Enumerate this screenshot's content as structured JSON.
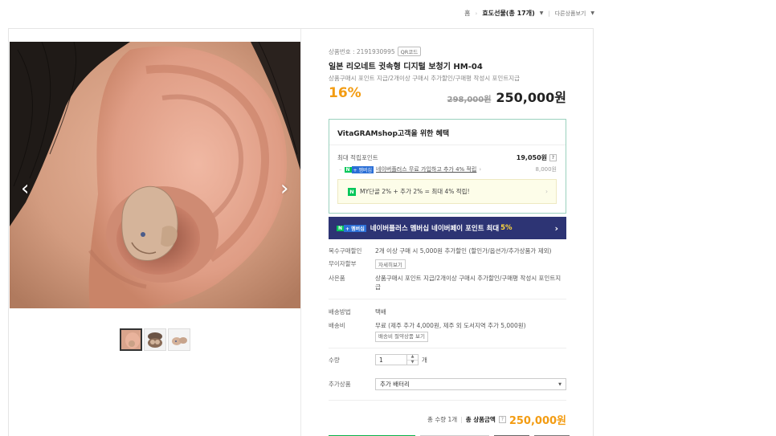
{
  "breadcrumb": {
    "home": "홈",
    "category": "효도선물(총 17개)",
    "other": "다른상품보기"
  },
  "product": {
    "number_label": "상품번호 : 2191930995",
    "qr_label": "QR코드",
    "title": "일본 리오네트 귓속형 디지털 보청기 HM-04",
    "description": "상품구매시 포인트 지급/2개이상 구매시 추가할인/구매평 작성시 포인트지급",
    "discount": "16%",
    "original_price": "298,000원",
    "sale_price": "250,000원"
  },
  "benefit": {
    "title": "VitaGRAMshop고객을 위한 혜택",
    "points_label": "최대 적립포인트",
    "points_value": "19,050원",
    "help": "?",
    "naver_badge_n": "N",
    "naver_badge_plus": "+ 멤버십",
    "naver_text": "네이버플러스 무료 가입하고 추가 4% 적립",
    "naver_amount": "8,000원",
    "my_text": "MY단골 2% + 추가 2% = 최대 4% 적립!",
    "my_badge": "N"
  },
  "banner": {
    "badge_n": "N",
    "badge_plus": "+ 멤버십",
    "text": "네이버플러스 멤버십 네이버페이 포인트 최대",
    "highlight": "5%"
  },
  "info_rows": {
    "multi_label": "복수구매할인",
    "multi_value": "2개 이상 구매 시 5,000원 추가할인 (할인가/옵션가/추가상품가 제외)",
    "interest_label": "무이자할부",
    "interest_btn": "자세히보기",
    "gift_label": "사은품",
    "gift_value": "상품구매시 포인트 지급/2개이상 구매시 추가할인/구매평 작성시 포인트지급",
    "ship_method_label": "배송방법",
    "ship_method_value": "택배",
    "ship_fee_label": "배송비",
    "ship_fee_value": "무료 (제주 추가 4,000원, 제주 외 도서지역 추가 5,000원)",
    "ship_fee_btn": "배송비 절약상품 보기",
    "qty_label": "수량",
    "qty_value": "1",
    "qty_unit": "개",
    "addon_label": "추가상품",
    "addon_value": "추가 배터리"
  },
  "total": {
    "qty_text": "총 수량 1개",
    "amount_label": "총 상품금액",
    "help": "?",
    "amount": "250,000원"
  },
  "colors": {
    "accent_orange": "#f39c12",
    "naver_green": "#03c75a",
    "banner_navy": "#2d3474"
  },
  "icons": [
    "chevron-left-icon",
    "chevron-right-icon",
    "caret-down-icon",
    "question-icon"
  ]
}
